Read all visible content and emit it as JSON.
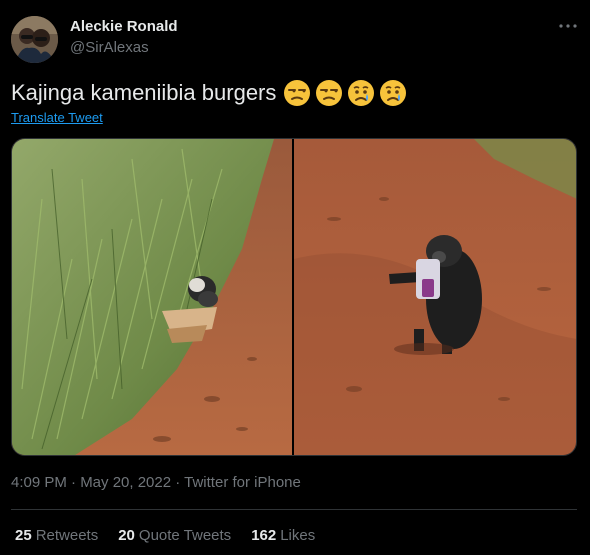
{
  "author": {
    "name": "Aleckie Ronald",
    "handle": "@SirAlexas"
  },
  "tweet": {
    "text": "Kajinga kameniibia burgers",
    "emojis": [
      "unamused-face",
      "unamused-face",
      "crying-face",
      "crying-face"
    ],
    "translate_label": "Translate Tweet",
    "meta": "4:09 PM · May 20, 2022 · Twitter for iPhone"
  },
  "stats": [
    {
      "count": "25",
      "label": "Retweets"
    },
    {
      "count": "20",
      "label": "Quote Tweets"
    },
    {
      "count": "162",
      "label": "Likes"
    }
  ],
  "icons": {
    "more": "more-horizontal-icon"
  },
  "colors": {
    "background": "#000000",
    "text": "#e7e9ea",
    "secondary": "#71767b",
    "link": "#1d9bf0",
    "border": "#2f3336"
  }
}
